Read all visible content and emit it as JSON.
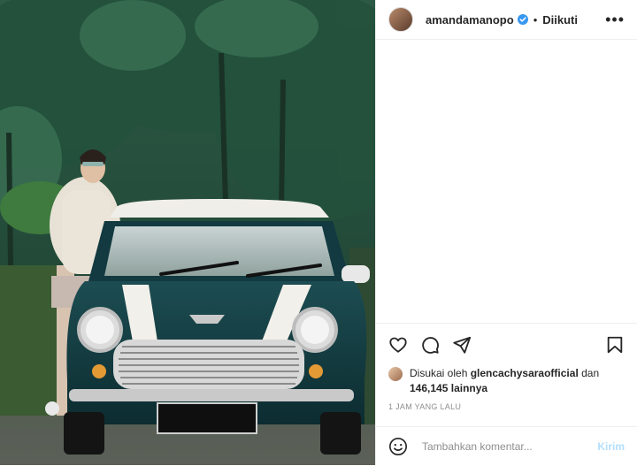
{
  "header": {
    "username": "amandamanopo",
    "dot": "•",
    "follow_state": "Diikuti",
    "more": "•••"
  },
  "likes": {
    "prefix": "Disukai oleh",
    "liker": "glencachysaraofficial",
    "and": "dan",
    "count": "146,145",
    "suffix": "lainnya"
  },
  "timestamp": "1 JAM YANG LALU",
  "composer": {
    "placeholder": "Tambahkan komentar...",
    "send_label": "Kirim"
  },
  "icons": {
    "like": "heart-icon",
    "comment": "comment-icon",
    "share": "share-icon",
    "save": "bookmark-icon",
    "emoji": "emoji-icon",
    "verified": "verified-badge-icon",
    "more": "more-options-icon"
  },
  "colors": {
    "verified": "#3897f0",
    "send_disabled": "#b2dffc",
    "muted": "#8e8e8e",
    "car_body": "#0f3a3a"
  }
}
